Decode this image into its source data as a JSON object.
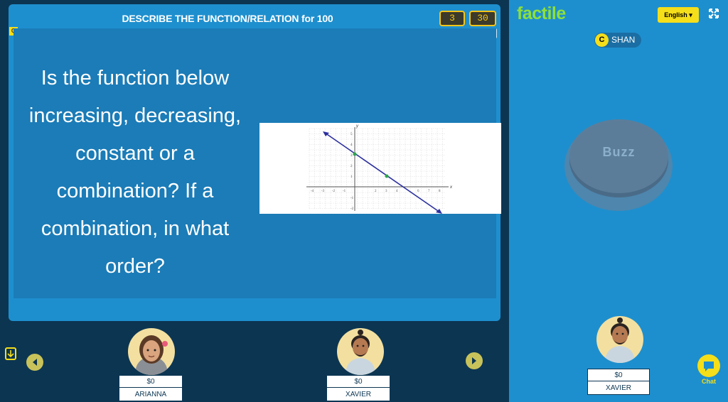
{
  "game": {
    "title": "DESCRIBE THE FUNCTION/RELATION for 100",
    "counter_left": "3",
    "counter_right": "30",
    "q_tag": "Q",
    "question": "Is the function below increasing, decreasing, constant or a combination? If a combination, in what order?",
    "graph": {
      "x_ticks": [
        "-4",
        "-3",
        "-2",
        "-1",
        "2",
        "3",
        "4",
        "6",
        "7",
        "8"
      ],
      "y_ticks": [
        "5",
        "4",
        "3",
        "2",
        "1",
        "-1",
        "-2"
      ],
      "x_axis_label": "x",
      "y_axis_label": "y",
      "line_color": "#2b2f9e",
      "point_color": "#2aa84a"
    }
  },
  "players": [
    {
      "name": "ARIANNA",
      "score": "$0"
    },
    {
      "name": "XAVIER",
      "score": "$0"
    }
  ],
  "sidebar": {
    "logo": "factile",
    "language": "English",
    "current_team_badge": "C",
    "current_player": "SHAN",
    "buzz_label": "Buzz",
    "self_player": {
      "name": "XAVIER",
      "score": "$0"
    },
    "chat_label": "Chat"
  },
  "colors": {
    "board": "#1e8fce",
    "panel": "#1b7cb7",
    "background": "#0c3552",
    "accent_yellow": "#f5de1a",
    "logo_green": "#8de03b"
  }
}
